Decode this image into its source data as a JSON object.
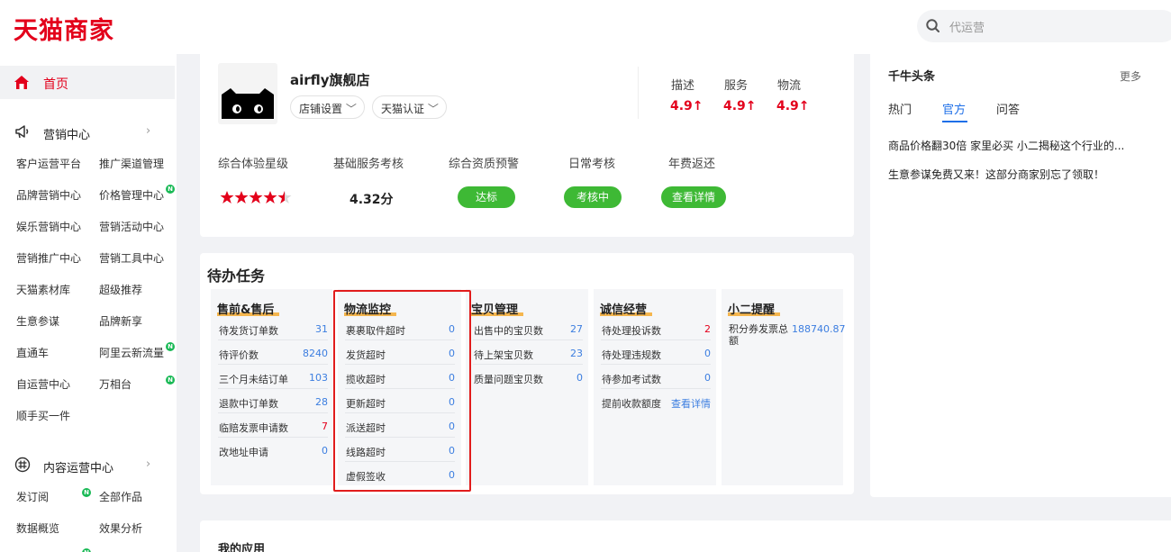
{
  "header": {
    "logo": "天猫商家",
    "search_placeholder": "代运营"
  },
  "sidebar": {
    "home": "首页",
    "marketing": {
      "title": "营销中心",
      "items": [
        "客户运营平台",
        "推广渠道管理",
        "品牌营销中心",
        "价格管理中心",
        "娱乐营销中心",
        "营销活动中心",
        "营销推广中心",
        "营销工具中心",
        "天猫素材库",
        "超级推荐",
        "生意参谋",
        "品牌新享",
        "直通车",
        "阿里云新流量",
        "自运营中心",
        "万相台",
        "顺手买一件"
      ]
    },
    "content": {
      "title": "内容运营中心",
      "items": [
        "发订阅",
        "全部作品",
        "数据概览",
        "效果分析"
      ]
    },
    "badge": "N"
  },
  "shop": {
    "name": "airfly旗舰店",
    "settings_btn": "店铺设置",
    "cert_btn": "天猫认证",
    "ratings": [
      {
        "label": "描述",
        "value": "4.9↑"
      },
      {
        "label": "服务",
        "value": "4.9↑"
      },
      {
        "label": "物流",
        "value": "4.9↑"
      }
    ],
    "metrics": {
      "experience": "综合体验星级",
      "basic": "基础服务考核",
      "qualification": "综合资质预警",
      "daily": "日常考核",
      "fee": "年费返还"
    },
    "stars": 4.5,
    "score": "4.32分",
    "qualification_status": "达标",
    "daily_status": "考核中",
    "fee_action": "查看详情"
  },
  "todo": {
    "title": "待办任务",
    "panels": [
      {
        "title": "售前&售后",
        "rows": [
          {
            "label": "待发货订单数",
            "value": "31"
          },
          {
            "label": "待评价数",
            "value": "8240"
          },
          {
            "label": "三个月未结订单",
            "value": "103"
          },
          {
            "label": "退款中订单数",
            "value": "28"
          },
          {
            "label": "临赔发票申请数",
            "value": "7"
          },
          {
            "label": "改地址申请",
            "value": "0"
          }
        ]
      },
      {
        "title": "物流监控",
        "rows": [
          {
            "label": "裹裹取件超时",
            "value": "0"
          },
          {
            "label": "发货超时",
            "value": "0"
          },
          {
            "label": "揽收超时",
            "value": "0"
          },
          {
            "label": "更新超时",
            "value": "0"
          },
          {
            "label": "派送超时",
            "value": "0"
          },
          {
            "label": "线路超时",
            "value": "0"
          },
          {
            "label": "虚假签收",
            "value": "0"
          }
        ]
      },
      {
        "title": "宝贝管理",
        "rows": [
          {
            "label": "出售中的宝贝数",
            "value": "27"
          },
          {
            "label": "待上架宝贝数",
            "value": "23"
          },
          {
            "label": "质量问题宝贝数",
            "value": "0"
          }
        ]
      },
      {
        "title": "诚信经营",
        "rows": [
          {
            "label": "待处理投诉数",
            "value": "2"
          },
          {
            "label": "待处理违规数",
            "value": "0"
          },
          {
            "label": "待参加考试数",
            "value": "0"
          },
          {
            "label": "提前收款额度",
            "value": "查看详情"
          }
        ]
      },
      {
        "title": "小二提醒",
        "rows": [
          {
            "label": "积分券发票总额",
            "value": "188740.87"
          }
        ]
      }
    ]
  },
  "news": {
    "title": "千牛头条",
    "more": "更多",
    "tabs": [
      "热门",
      "官方",
      "问答"
    ],
    "active_tab": "官方",
    "items": [
      "商品价格翻30倍 家里必买 小二揭秘这个行业的...",
      "生意参谋免费又来！这部分商家别忘了领取！"
    ]
  },
  "myapps": {
    "title": "我的应用"
  },
  "colors": {
    "brand_red": "#e3001b",
    "accent_blue": "#1e6fe8",
    "status_green": "#3eb935",
    "highlight_red": "#e11c1c"
  }
}
